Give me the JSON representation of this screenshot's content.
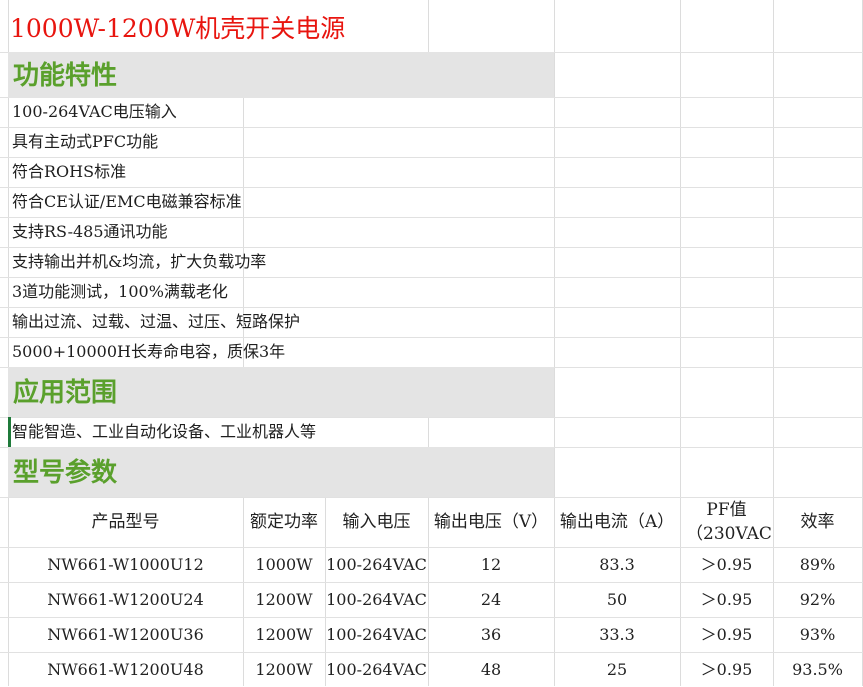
{
  "title": "1000W-1200W机壳开关电源",
  "sections": {
    "features": "功能特性",
    "applications": "应用范围",
    "models": "型号参数"
  },
  "features": [
    "100-264VAC电压输入",
    "具有主动式PFC功能",
    "符合ROHS标准",
    "符合CE认证/EMC电磁兼容标准",
    "支持RS-485通讯功能",
    "支持输出并机&均流，扩大负载功率",
    "3道功能测试，100%满载老化",
    "输出过流、过载、过温、过压、短路保护",
    "5000+10000H长寿命电容，质保3年"
  ],
  "applications": "智能智造、工业自动化设备、工业机器人等",
  "table": {
    "headers": [
      "产品型号",
      "额定功率",
      "输入电压",
      "输出电压（V）",
      "输出电流（A）",
      "PF值",
      "（230VAC",
      "效率"
    ],
    "rows": [
      [
        "NW661-W1000U12",
        "1000W",
        "100-264VAC",
        "12",
        "83.3",
        "＞0.95",
        "89%"
      ],
      [
        "NW661-W1200U24",
        "1200W",
        "100-264VAC",
        "24",
        "50",
        "＞0.95",
        "92%"
      ],
      [
        "NW661-W1200U36",
        "1200W",
        "100-264VAC",
        "36",
        "33.3",
        "＞0.95",
        "93%"
      ],
      [
        "NW661-W1200U48",
        "1200W",
        "100-264VAC",
        "48",
        "25",
        "＞0.95",
        "93.5%"
      ]
    ]
  },
  "colors": {
    "title": "#e8150f",
    "section_text": "#5aa02c",
    "section_bg": "#e4e4e4",
    "grid": "#dcdcdc"
  }
}
